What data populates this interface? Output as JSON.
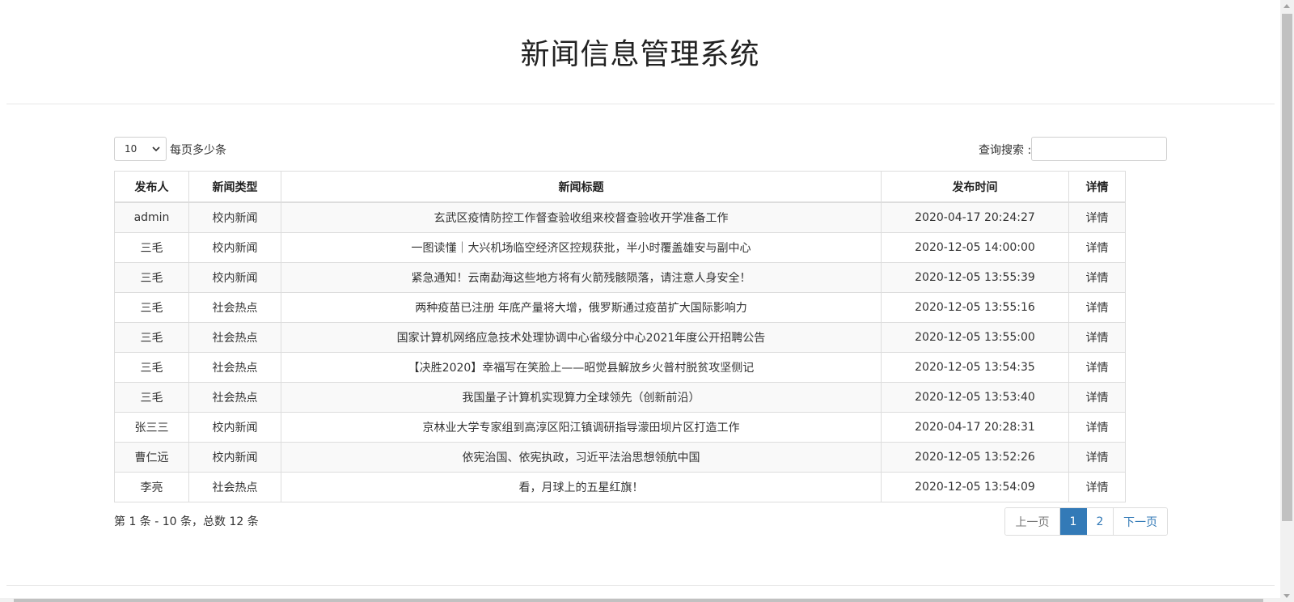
{
  "title": "新闻信息管理系统",
  "controls": {
    "page_size": "10",
    "page_size_label": "每页多少条",
    "search_label": "查询搜索 :",
    "search_value": ""
  },
  "table": {
    "headers": [
      "发布人",
      "新闻类型",
      "新闻标题",
      "发布时间",
      "详情"
    ],
    "rows": [
      [
        "admin",
        "校内新闻",
        "玄武区疫情防控工作督查验收组来校督查验收开学准备工作",
        "2020-04-17 20:24:27",
        "详情"
      ],
      [
        "三毛",
        "校内新闻",
        "一图读懂｜大兴机场临空经济区控规获批，半小时覆盖雄安与副中心",
        "2020-12-05 14:00:00",
        "详情"
      ],
      [
        "三毛",
        "校内新闻",
        "紧急通知！云南勐海这些地方将有火箭残骸陨落，请注意人身安全！",
        "2020-12-05 13:55:39",
        "详情"
      ],
      [
        "三毛",
        "社会热点",
        "两种疫苗已注册 年底产量将大增，俄罗斯通过疫苗扩大国际影响力",
        "2020-12-05 13:55:16",
        "详情"
      ],
      [
        "三毛",
        "社会热点",
        "国家计算机网络应急技术处理协调中心省级分中心2021年度公开招聘公告",
        "2020-12-05 13:55:00",
        "详情"
      ],
      [
        "三毛",
        "社会热点",
        "【决胜2020】幸福写在笑脸上——昭觉县解放乡火普村脱贫攻坚侧记",
        "2020-12-05 13:54:35",
        "详情"
      ],
      [
        "三毛",
        "社会热点",
        "我国量子计算机实现算力全球领先（创新前沿）",
        "2020-12-05 13:53:40",
        "详情"
      ],
      [
        "张三三",
        "校内新闻",
        "京林业大学专家组到高淳区阳江镇调研指导濛田坝片区打造工作",
        "2020-04-17 20:28:31",
        "详情"
      ],
      [
        "曹仁远",
        "校内新闻",
        "依宪治国、依宪执政，习近平法治思想领航中国",
        "2020-12-05 13:52:26",
        "详情"
      ],
      [
        "李亮",
        "社会热点",
        "看，月球上的五星红旗！",
        "2020-12-05 13:54:09",
        "详情"
      ]
    ]
  },
  "summary": "第 1 条 - 10 条，总数 12 条",
  "pagination": {
    "prev": "上一页",
    "pages": [
      "1",
      "2"
    ],
    "active": "1",
    "next": "下一页"
  },
  "colors": {
    "accent": "#337ab7",
    "border": "#dddddd",
    "stripe": "#f9f9f9"
  }
}
